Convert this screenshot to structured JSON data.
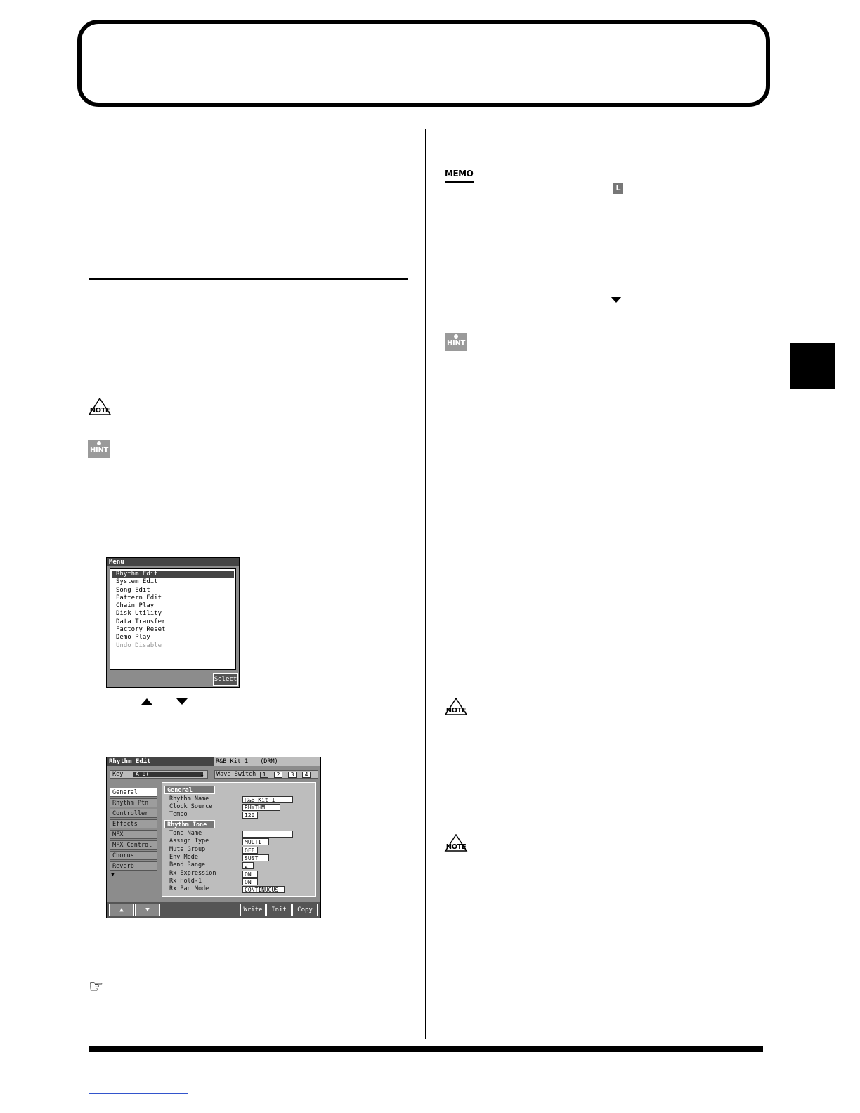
{
  "icons": {
    "note": "NOTE",
    "hint": "HINT",
    "memo": "MEMO",
    "reference": "☞",
    "l_marker": "L"
  },
  "menu_screen": {
    "title": "Menu",
    "items": [
      {
        "label": "Rhythm Edit",
        "selected": true
      },
      {
        "label": "System Edit"
      },
      {
        "label": "Song Edit"
      },
      {
        "label": "Pattern Edit"
      },
      {
        "label": "Chain Play"
      },
      {
        "label": "Disk Utility"
      },
      {
        "label": "Data Transfer"
      },
      {
        "label": "Factory Reset"
      },
      {
        "label": "Demo Play"
      },
      {
        "label": "Undo Disable",
        "disabled": true
      }
    ],
    "select_button": "Select"
  },
  "rhythm_edit_screen": {
    "title": "Rhythm Edit",
    "kit_name": "R&B Kit 1",
    "kit_group": "(DRM)",
    "key_label": "Key",
    "key_value": "A 0(",
    "key_num": "1",
    "wave_switch_label": "Wave Switch",
    "wave_switch": [
      "1",
      "2",
      "3",
      "4"
    ],
    "tabs": [
      "General",
      "Rhythm Ptn",
      "Controller",
      "Effects",
      "MFX",
      "MFX Control",
      "Chorus",
      "Reverb"
    ],
    "section_general": "General",
    "section_tone": "Rhythm Tone",
    "general_params": [
      {
        "label": "Rhythm Name",
        "value": "R&B Kit 1"
      },
      {
        "label": "Clock Source",
        "value": "RHYTHM"
      },
      {
        "label": "Tempo",
        "value": "120"
      }
    ],
    "tone_params": [
      {
        "label": "Tone Name",
        "value": ""
      },
      {
        "label": "Assign Type",
        "value": "MULTI"
      },
      {
        "label": "Mute Group",
        "value": "OFF"
      },
      {
        "label": "Env Mode",
        "value": "SUST"
      },
      {
        "label": "Bend Range",
        "value": "2"
      },
      {
        "label": "Rx Expression",
        "value": "ON"
      },
      {
        "label": "Rx Hold-1",
        "value": "ON"
      },
      {
        "label": "Rx Pan Mode",
        "value": "CONTINUOUS"
      }
    ],
    "buttons": [
      "Write",
      "Init",
      "Copy"
    ]
  }
}
